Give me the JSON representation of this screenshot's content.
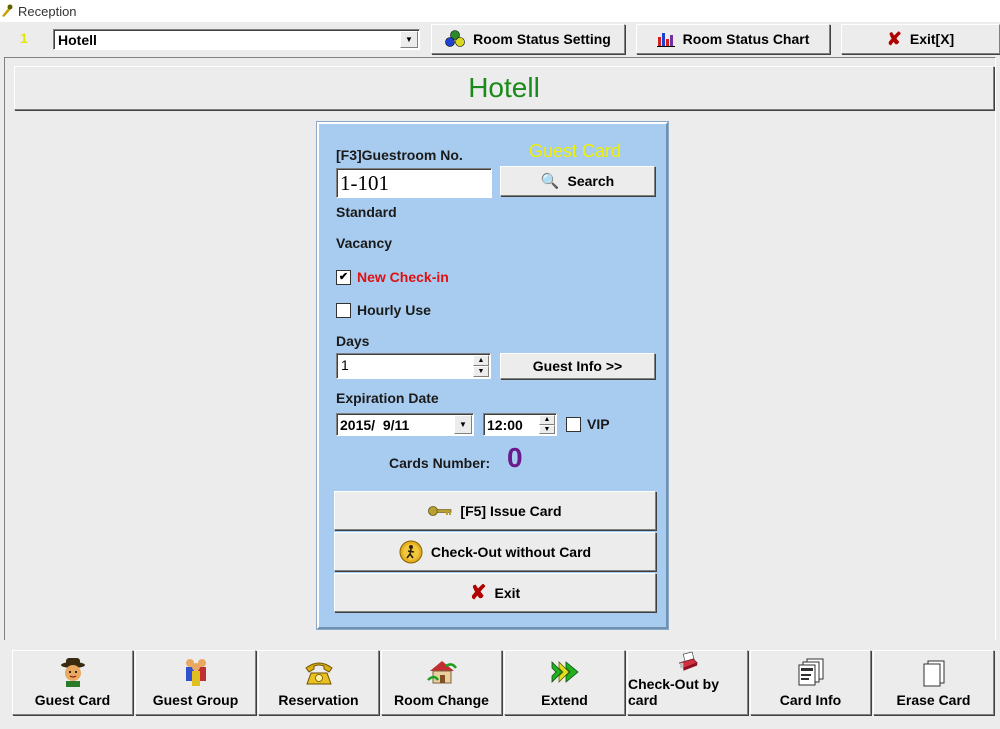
{
  "window": {
    "title": "Reception"
  },
  "toolbar": {
    "indicator": "1",
    "hotel_select": "Hotell",
    "room_status_setting": "Room Status Setting",
    "room_status_chart": "Room Status Chart",
    "exit": "Exit[X]"
  },
  "header": {
    "hotel_name": "Hotell",
    "color": "#1a8a1a"
  },
  "panel": {
    "guestroom_label": "[F3]Guestroom No.",
    "card_type": "Guest Card",
    "guestroom_value": "1-101",
    "search": "Search",
    "room_type": "Standard",
    "room_state": "Vacancy",
    "new_checkin": "New Check-in",
    "new_checkin_checked": true,
    "hourly_use": "Hourly Use",
    "hourly_use_checked": false,
    "days_label": "Days",
    "days_value": "1",
    "guest_info": "Guest Info >>",
    "expiration_label": "Expiration Date",
    "expiration_date": "2015/  9/11",
    "expiration_time": "12:00",
    "vip": "VIP",
    "vip_checked": false,
    "cards_number_label": "Cards Number:",
    "cards_number_value": "0",
    "issue_card": "[F5] Issue Card",
    "checkout_without_card": "Check-Out without Card",
    "exit": "Exit"
  },
  "bottom": [
    {
      "label": "Guest Card",
      "icon": "guest-card-icon"
    },
    {
      "label": "Guest Group",
      "icon": "guest-group-icon"
    },
    {
      "label": "Reservation",
      "icon": "telephone-icon"
    },
    {
      "label": "Room Change",
      "icon": "house-icon"
    },
    {
      "label": "Extend",
      "icon": "arrow-forward-icon"
    },
    {
      "label": "Check-Out by card",
      "icon": "card-reader-icon"
    },
    {
      "label": "Card Info",
      "icon": "card-stack-icon"
    },
    {
      "label": "Erase Card",
      "icon": "blank-card-icon"
    }
  ]
}
